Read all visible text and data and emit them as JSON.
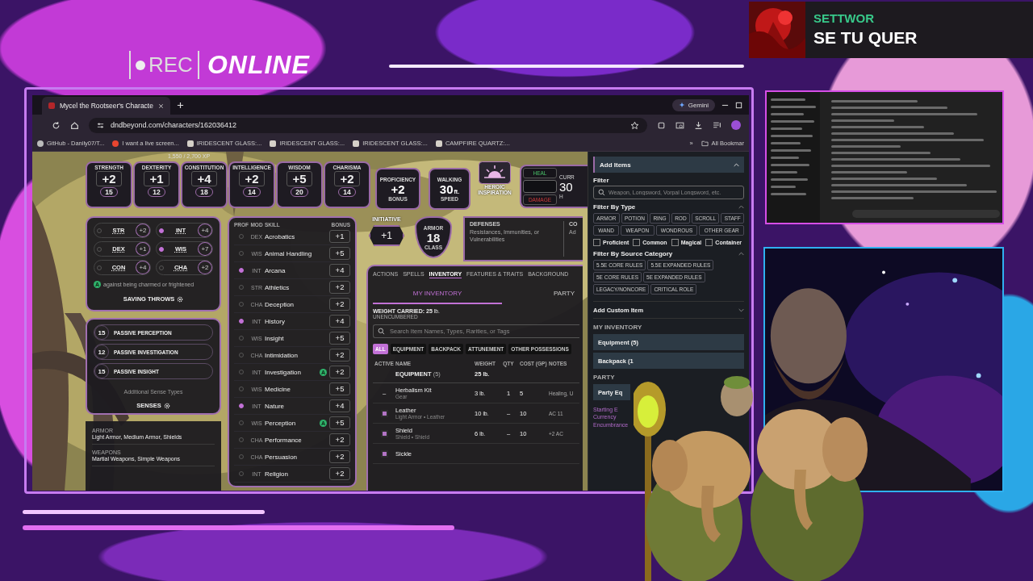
{
  "overlay": {
    "rec_label": "REC",
    "status": "ONLINE"
  },
  "now_playing": {
    "artist": "SETTWOR",
    "title": "SE TU QUER"
  },
  "browser": {
    "tab": {
      "title": "Mycel the Rootseer's Characte",
      "selected": true
    },
    "gemini": "Gemini",
    "url": "dndbeyond.com/characters/162036412",
    "bookmarks": [
      "GitHub - Danily07/T...",
      "I want a live screen...",
      "IRIDESCENT GLASS:...",
      "IRIDESCENT GLASS:...",
      "IRIDESCENT GLASS:...",
      "CAMPFIRE QUARTZ:..."
    ],
    "more": "»",
    "all_bookmarks": "All Bookmar"
  },
  "sheet": {
    "xp": "1,550 / 2,700 XP",
    "abilities": [
      {
        "name": "STRENGTH",
        "modifier": "+2",
        "score": "15"
      },
      {
        "name": "DEXTERITY",
        "modifier": "+1",
        "score": "12"
      },
      {
        "name": "CONSTITUTION",
        "modifier": "+4",
        "score": "18"
      },
      {
        "name": "INTELLIGENCE",
        "modifier": "+2",
        "score": "14"
      },
      {
        "name": "WISDOM",
        "modifier": "+5",
        "score": "20"
      },
      {
        "name": "CHARISMA",
        "modifier": "+2",
        "score": "14"
      }
    ],
    "proficiency": {
      "label": "PROFICIENCY",
      "value": "+2",
      "sub": "BONUS"
    },
    "speed": {
      "label": "WALKING",
      "value": "30",
      "unit": "ft.",
      "sub": "SPEED"
    },
    "inspiration": {
      "label": "HEROIC INSPIRATION"
    },
    "hp": {
      "heal": "HEAL",
      "damage": "DAMAGE",
      "label": "CURR",
      "value": "30",
      "sub": "H"
    },
    "saving_throws": {
      "title": "SAVING THROWS",
      "items": [
        {
          "ability": "STR",
          "bonus": "+2",
          "proficient": false
        },
        {
          "ability": "INT",
          "bonus": "+4",
          "proficient": true
        },
        {
          "ability": "DEX",
          "bonus": "+1",
          "proficient": false
        },
        {
          "ability": "WIS",
          "bonus": "+7",
          "proficient": true
        },
        {
          "ability": "CON",
          "bonus": "+4",
          "proficient": false
        },
        {
          "ability": "CHA",
          "bonus": "+2",
          "proficient": false
        }
      ],
      "badge": "A",
      "note": "against being charmed or frightened"
    },
    "senses": {
      "title": "SENSES",
      "items": [
        {
          "value": "15",
          "label": "PASSIVE PERCEPTION"
        },
        {
          "value": "12",
          "label": "PASSIVE INVESTIGATION"
        },
        {
          "value": "15",
          "label": "PASSIVE INSIGHT"
        }
      ],
      "note": "Additional Sense Types"
    },
    "proficiencies": [
      {
        "heading": "ARMOR",
        "text": "Light Armor, Medium Armor, Shields"
      },
      {
        "heading": "WEAPONS",
        "text": "Martial Weapons, Simple Weapons"
      }
    ],
    "skills": {
      "columns": [
        "PROF",
        "MOD",
        "SKILL",
        "BONUS"
      ],
      "rows": [
        {
          "proficient": false,
          "mod": "DEX",
          "name": "Acrobatics",
          "bonus": "+1"
        },
        {
          "proficient": false,
          "mod": "WIS",
          "name": "Animal Handling",
          "bonus": "+5"
        },
        {
          "proficient": true,
          "mod": "INT",
          "name": "Arcana",
          "bonus": "+4"
        },
        {
          "proficient": false,
          "mod": "STR",
          "name": "Athletics",
          "bonus": "+2"
        },
        {
          "proficient": false,
          "mod": "CHA",
          "name": "Deception",
          "bonus": "+2"
        },
        {
          "proficient": true,
          "mod": "INT",
          "name": "History",
          "bonus": "+4"
        },
        {
          "proficient": false,
          "mod": "WIS",
          "name": "Insight",
          "bonus": "+5"
        },
        {
          "proficient": false,
          "mod": "CHA",
          "name": "Intimidation",
          "bonus": "+2"
        },
        {
          "proficient": false,
          "mod": "INT",
          "name": "Investigation",
          "bonus": "+2",
          "badge": "A"
        },
        {
          "proficient": false,
          "mod": "WIS",
          "name": "Medicine",
          "bonus": "+5"
        },
        {
          "proficient": true,
          "mod": "INT",
          "name": "Nature",
          "bonus": "+4"
        },
        {
          "proficient": false,
          "mod": "WIS",
          "name": "Perception",
          "bonus": "+5",
          "badge": "A"
        },
        {
          "proficient": false,
          "mod": "CHA",
          "name": "Performance",
          "bonus": "+2"
        },
        {
          "proficient": false,
          "mod": "CHA",
          "name": "Persuasion",
          "bonus": "+2"
        },
        {
          "proficient": false,
          "mod": "INT",
          "name": "Religion",
          "bonus": "+2"
        }
      ]
    },
    "initiative": {
      "label": "INITIATIVE",
      "value": "+1"
    },
    "armor_class": {
      "top": "ARMOR",
      "value": "18",
      "bottom": "CLASS"
    },
    "defenses": {
      "title": "DEFENSES",
      "text": "Resistances, Immunities, or Vulnerabilities"
    },
    "conditions": {
      "title": "CO",
      "text": "Ad"
    },
    "tabs": [
      {
        "label": "ACTIONS",
        "selected": false
      },
      {
        "label": "SPELLS",
        "selected": false
      },
      {
        "label": "INVENTORY",
        "selected": true
      },
      {
        "label": "FEATURES & TRAITS",
        "selected": false
      },
      {
        "label": "BACKGROUND",
        "selected": false
      }
    ],
    "inventory": {
      "subtabs": [
        {
          "label": "MY INVENTORY",
          "selected": true
        },
        {
          "label": "PARTY",
          "selected": false
        }
      ],
      "weight": "WEIGHT CARRIED: 25",
      "weight_unit": "lb.",
      "encumbrance": "UNENCUMBERED",
      "search_placeholder": "Search Item Names, Types, Rarities, or Tags",
      "filters": [
        {
          "label": "ALL",
          "selected": true
        },
        {
          "label": "EQUIPMENT",
          "selected": false
        },
        {
          "label": "BACKPACK",
          "selected": false
        },
        {
          "label": "ATTUNEMENT",
          "selected": false
        },
        {
          "label": "OTHER POSSESSIONS",
          "selected": false
        }
      ],
      "columns": [
        "ACTIVE",
        "NAME",
        "WEIGHT",
        "QTY",
        "COST (GP)",
        "NOTES"
      ],
      "group": {
        "name": "EQUIPMENT",
        "count": "(5)",
        "weight": "25",
        "unit": "lb."
      },
      "items": [
        {
          "kind": "dash",
          "active_text": "–",
          "name": "Herbalism Kit",
          "type": "Gear",
          "weight": "3",
          "unit": "lb.",
          "qty": "1",
          "cost": "5",
          "notes": "Healing, U"
        },
        {
          "kind": "toggle",
          "active": true,
          "name": "Leather",
          "type": "Light Armor • Leather",
          "weight": "10",
          "unit": "lb.",
          "qty": "–",
          "cost": "10",
          "notes": "AC 11"
        },
        {
          "kind": "toggle",
          "active": true,
          "name": "Shield",
          "type": "Shield • Shield",
          "weight": "6",
          "unit": "lb.",
          "qty": "–",
          "cost": "10",
          "notes": "+2 AC"
        },
        {
          "kind": "toggle",
          "active": true,
          "name": "Sickle"
        }
      ]
    }
  },
  "manage": {
    "add_items": {
      "label": "Add Items",
      "expanded": true
    },
    "filter_label": "Filter",
    "filter_placeholder": "Weapon, Longsword, Vorpal Longsword, etc.",
    "type_title": "Filter By Type",
    "types": [
      "ARMOR",
      "POTION",
      "RING",
      "ROD",
      "SCROLL",
      "STAFF",
      "WAND",
      "WEAPON",
      "WONDROUS",
      "OTHER GEAR"
    ],
    "checks": [
      {
        "label": "Proficient",
        "checked": false
      },
      {
        "label": "Common",
        "checked": false
      },
      {
        "label": "Magical",
        "checked": false
      },
      {
        "label": "Container",
        "checked": false
      }
    ],
    "source_title": "Filter By Source Category",
    "sources": [
      "5.5E CORE RULES",
      "5.5E EXPANDED RULES",
      "5E CORE RULES",
      "5E EXPANDED RULES",
      "LEGACY/NONCORE",
      "CRITICAL ROLE"
    ],
    "custom": {
      "label": "Add Custom Item",
      "expanded": false
    },
    "my_inventory": "MY INVENTORY",
    "groups": [
      "Equipment (5)",
      "Backpack (1"
    ],
    "party": "PARTY",
    "party_group": "Party Eq",
    "links": [
      "Starting E",
      "Currency",
      "Encumbrance"
    ]
  }
}
